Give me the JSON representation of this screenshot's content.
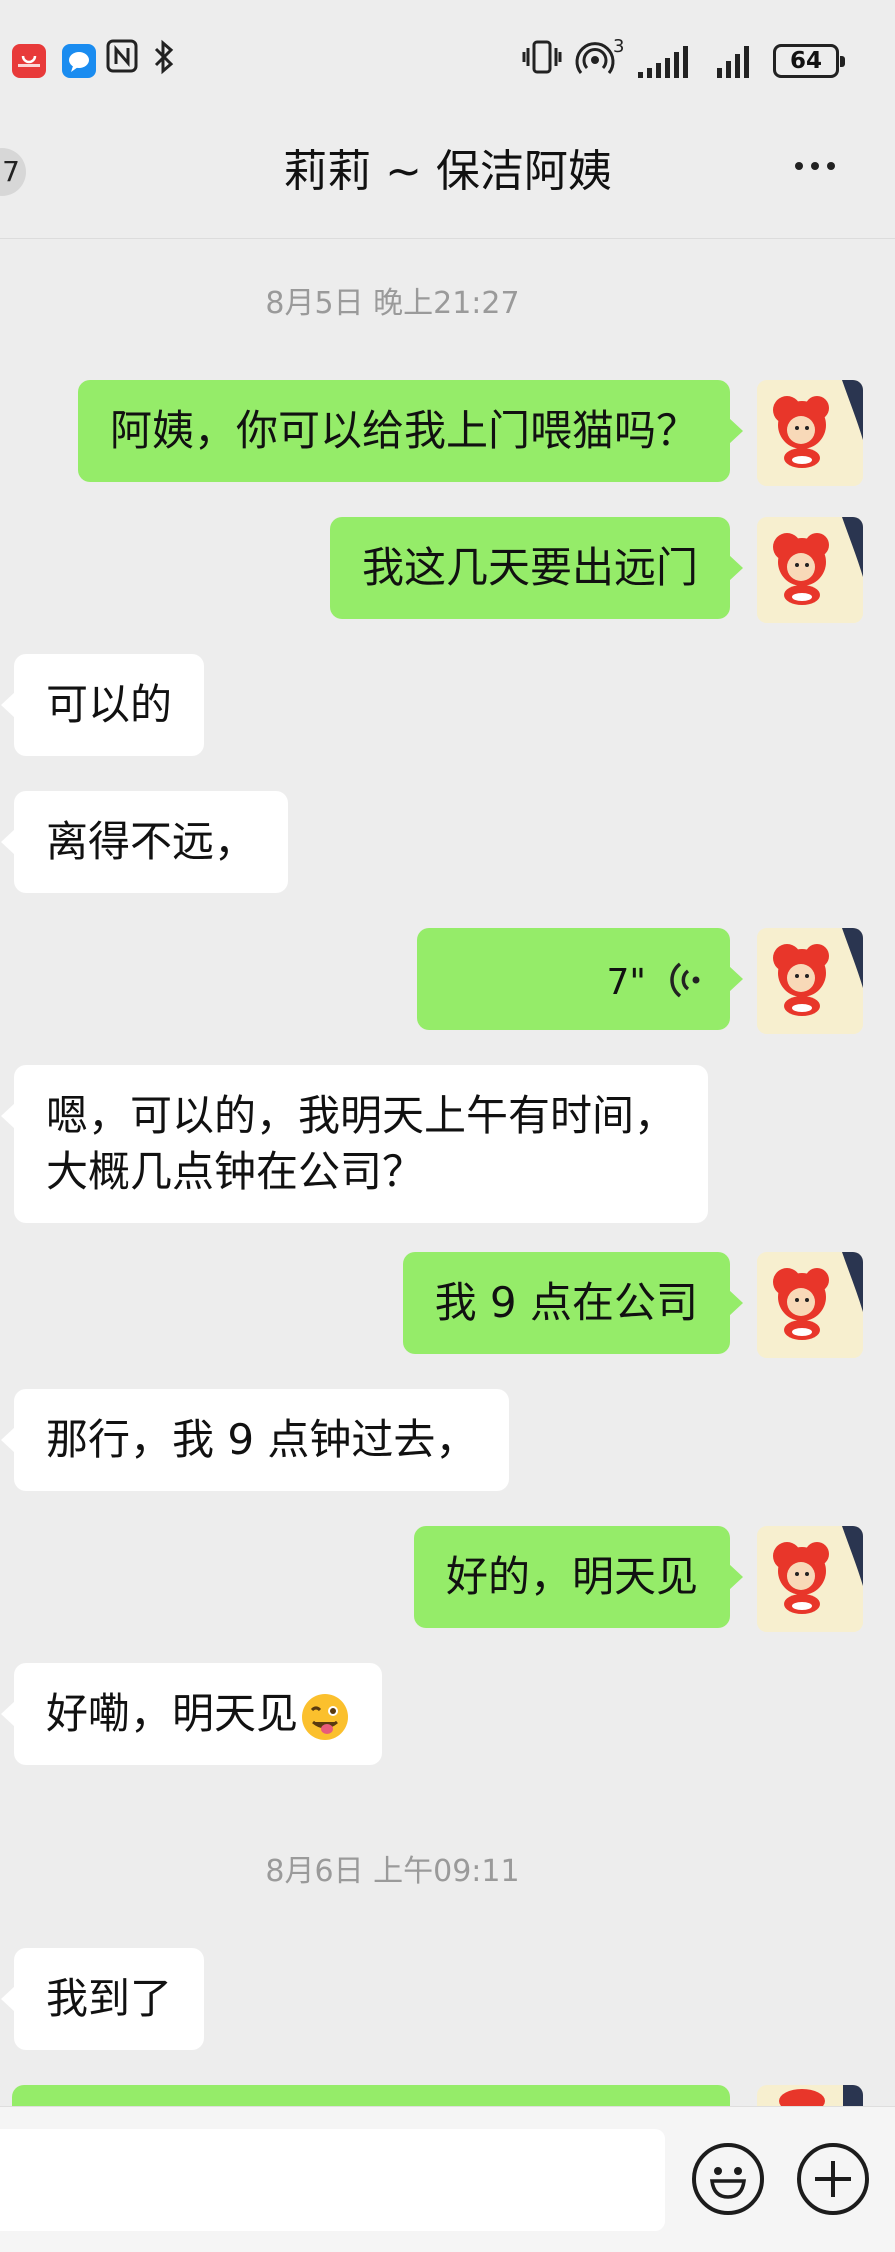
{
  "status_bar": {
    "icons": [
      "huawei-appgallery-icon",
      "message-app-icon",
      "nfc-icon",
      "bluetooth-icon",
      "vibrate-icon",
      "hotspot-icon",
      "signal-icon",
      "signal-icon",
      "battery-icon"
    ],
    "hotspot_count": "3",
    "battery_level": "64"
  },
  "header": {
    "back_badge": "7",
    "title": "莉莉 ~ 保洁阿姨",
    "more_icon": "more-dots-icon"
  },
  "timestamps": {
    "day1": "8月5日 晚上21:27",
    "day2": "8月6日 上午09:11"
  },
  "messages": [
    {
      "from": "me",
      "text": "阿姨，你可以给我上门喂猫吗？"
    },
    {
      "from": "me",
      "text": "我这几天要出远门"
    },
    {
      "from": "them",
      "text": "可以的"
    },
    {
      "from": "them",
      "text": "离得不远，"
    },
    {
      "from": "me",
      "type": "voice",
      "duration": "7\""
    },
    {
      "from": "them",
      "lines": [
        "嗯，可以的，我明天上午有时间，",
        "大概几点钟在公司？"
      ]
    },
    {
      "from": "me",
      "text": "我 9 点在公司"
    },
    {
      "from": "them",
      "text": "那行，我 9 点钟过去，"
    },
    {
      "from": "me",
      "text": "好的，明天见"
    },
    {
      "from": "them",
      "text": "好嘞，明天见",
      "emoji": "winking-face-tongue-emoji"
    },
    {
      "from": "them",
      "text": "我到了"
    }
  ],
  "input_bar": {
    "emoji_icon": "smiley-icon",
    "plus_icon": "plus-icon"
  },
  "colors": {
    "background": "#ededed",
    "my_bubble": "#95ec69",
    "their_bubble": "#ffffff",
    "timestamp": "#9a9a9a"
  }
}
